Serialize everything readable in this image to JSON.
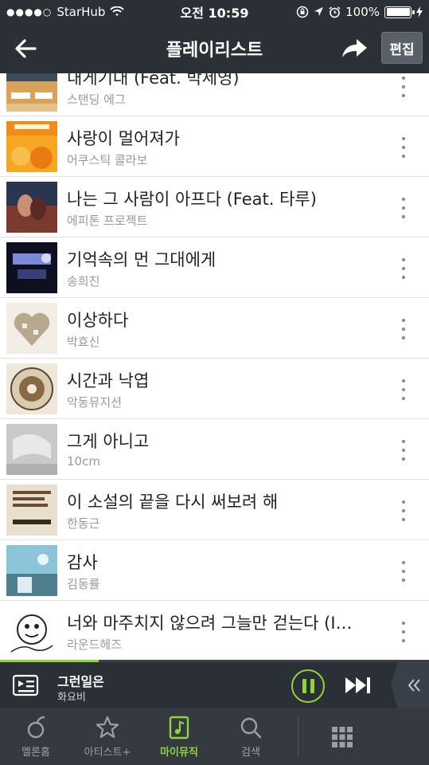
{
  "status_bar": {
    "carrier": "StarHub",
    "time": "오전 10:59",
    "battery": "100%"
  },
  "header": {
    "title": "플레이리스트",
    "edit_label": "편집"
  },
  "songs": [
    {
      "title": "내게기대 (Feat. 박세영)",
      "artist": "스탠딩 에그"
    },
    {
      "title": "사랑이 멀어져가",
      "artist": "어쿠스틱 콜라보"
    },
    {
      "title": "나는 그 사람이 아프다 (Feat. 타루)",
      "artist": "에피톤 프로젝트"
    },
    {
      "title": "기억속의 먼 그대에게",
      "artist": "송희진"
    },
    {
      "title": "이상하다",
      "artist": "박효신"
    },
    {
      "title": "시간과 낙엽",
      "artist": "악동뮤지션"
    },
    {
      "title": "그게 아니고",
      "artist": "10cm"
    },
    {
      "title": "이 소설의 끝을 다시 써보려 해",
      "artist": "한동근"
    },
    {
      "title": "감사",
      "artist": "김동률"
    },
    {
      "title": "너와 마주치지 않으려 그늘만 걷는다 (I…",
      "artist": "라운드헤즈"
    }
  ],
  "now_playing": {
    "title": "그런일은",
    "artist": "화요비",
    "progress": 0.23
  },
  "tabs": [
    {
      "label": "멜론홈",
      "icon": "melon-home-icon",
      "active": false
    },
    {
      "label": "아티스트+",
      "icon": "star-icon",
      "active": false
    },
    {
      "label": "마이뮤직",
      "icon": "music-note-icon",
      "active": true
    },
    {
      "label": "검색",
      "icon": "search-icon",
      "active": false
    }
  ],
  "colors": {
    "accent": "#8fd33f",
    "bar_background": "#2b3037"
  }
}
